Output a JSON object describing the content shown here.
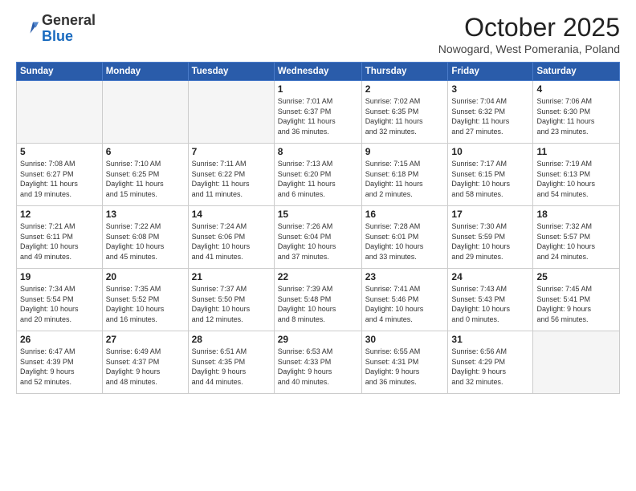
{
  "header": {
    "logo_general": "General",
    "logo_blue": "Blue",
    "month_title": "October 2025",
    "subtitle": "Nowogard, West Pomerania, Poland"
  },
  "weekdays": [
    "Sunday",
    "Monday",
    "Tuesday",
    "Wednesday",
    "Thursday",
    "Friday",
    "Saturday"
  ],
  "weeks": [
    [
      {
        "day": "",
        "text": ""
      },
      {
        "day": "",
        "text": ""
      },
      {
        "day": "",
        "text": ""
      },
      {
        "day": "1",
        "text": "Sunrise: 7:01 AM\nSunset: 6:37 PM\nDaylight: 11 hours\nand 36 minutes."
      },
      {
        "day": "2",
        "text": "Sunrise: 7:02 AM\nSunset: 6:35 PM\nDaylight: 11 hours\nand 32 minutes."
      },
      {
        "day": "3",
        "text": "Sunrise: 7:04 AM\nSunset: 6:32 PM\nDaylight: 11 hours\nand 27 minutes."
      },
      {
        "day": "4",
        "text": "Sunrise: 7:06 AM\nSunset: 6:30 PM\nDaylight: 11 hours\nand 23 minutes."
      }
    ],
    [
      {
        "day": "5",
        "text": "Sunrise: 7:08 AM\nSunset: 6:27 PM\nDaylight: 11 hours\nand 19 minutes."
      },
      {
        "day": "6",
        "text": "Sunrise: 7:10 AM\nSunset: 6:25 PM\nDaylight: 11 hours\nand 15 minutes."
      },
      {
        "day": "7",
        "text": "Sunrise: 7:11 AM\nSunset: 6:22 PM\nDaylight: 11 hours\nand 11 minutes."
      },
      {
        "day": "8",
        "text": "Sunrise: 7:13 AM\nSunset: 6:20 PM\nDaylight: 11 hours\nand 6 minutes."
      },
      {
        "day": "9",
        "text": "Sunrise: 7:15 AM\nSunset: 6:18 PM\nDaylight: 11 hours\nand 2 minutes."
      },
      {
        "day": "10",
        "text": "Sunrise: 7:17 AM\nSunset: 6:15 PM\nDaylight: 10 hours\nand 58 minutes."
      },
      {
        "day": "11",
        "text": "Sunrise: 7:19 AM\nSunset: 6:13 PM\nDaylight: 10 hours\nand 54 minutes."
      }
    ],
    [
      {
        "day": "12",
        "text": "Sunrise: 7:21 AM\nSunset: 6:11 PM\nDaylight: 10 hours\nand 49 minutes."
      },
      {
        "day": "13",
        "text": "Sunrise: 7:22 AM\nSunset: 6:08 PM\nDaylight: 10 hours\nand 45 minutes."
      },
      {
        "day": "14",
        "text": "Sunrise: 7:24 AM\nSunset: 6:06 PM\nDaylight: 10 hours\nand 41 minutes."
      },
      {
        "day": "15",
        "text": "Sunrise: 7:26 AM\nSunset: 6:04 PM\nDaylight: 10 hours\nand 37 minutes."
      },
      {
        "day": "16",
        "text": "Sunrise: 7:28 AM\nSunset: 6:01 PM\nDaylight: 10 hours\nand 33 minutes."
      },
      {
        "day": "17",
        "text": "Sunrise: 7:30 AM\nSunset: 5:59 PM\nDaylight: 10 hours\nand 29 minutes."
      },
      {
        "day": "18",
        "text": "Sunrise: 7:32 AM\nSunset: 5:57 PM\nDaylight: 10 hours\nand 24 minutes."
      }
    ],
    [
      {
        "day": "19",
        "text": "Sunrise: 7:34 AM\nSunset: 5:54 PM\nDaylight: 10 hours\nand 20 minutes."
      },
      {
        "day": "20",
        "text": "Sunrise: 7:35 AM\nSunset: 5:52 PM\nDaylight: 10 hours\nand 16 minutes."
      },
      {
        "day": "21",
        "text": "Sunrise: 7:37 AM\nSunset: 5:50 PM\nDaylight: 10 hours\nand 12 minutes."
      },
      {
        "day": "22",
        "text": "Sunrise: 7:39 AM\nSunset: 5:48 PM\nDaylight: 10 hours\nand 8 minutes."
      },
      {
        "day": "23",
        "text": "Sunrise: 7:41 AM\nSunset: 5:46 PM\nDaylight: 10 hours\nand 4 minutes."
      },
      {
        "day": "24",
        "text": "Sunrise: 7:43 AM\nSunset: 5:43 PM\nDaylight: 10 hours\nand 0 minutes."
      },
      {
        "day": "25",
        "text": "Sunrise: 7:45 AM\nSunset: 5:41 PM\nDaylight: 9 hours\nand 56 minutes."
      }
    ],
    [
      {
        "day": "26",
        "text": "Sunrise: 6:47 AM\nSunset: 4:39 PM\nDaylight: 9 hours\nand 52 minutes."
      },
      {
        "day": "27",
        "text": "Sunrise: 6:49 AM\nSunset: 4:37 PM\nDaylight: 9 hours\nand 48 minutes."
      },
      {
        "day": "28",
        "text": "Sunrise: 6:51 AM\nSunset: 4:35 PM\nDaylight: 9 hours\nand 44 minutes."
      },
      {
        "day": "29",
        "text": "Sunrise: 6:53 AM\nSunset: 4:33 PM\nDaylight: 9 hours\nand 40 minutes."
      },
      {
        "day": "30",
        "text": "Sunrise: 6:55 AM\nSunset: 4:31 PM\nDaylight: 9 hours\nand 36 minutes."
      },
      {
        "day": "31",
        "text": "Sunrise: 6:56 AM\nSunset: 4:29 PM\nDaylight: 9 hours\nand 32 minutes."
      },
      {
        "day": "",
        "text": ""
      }
    ]
  ]
}
